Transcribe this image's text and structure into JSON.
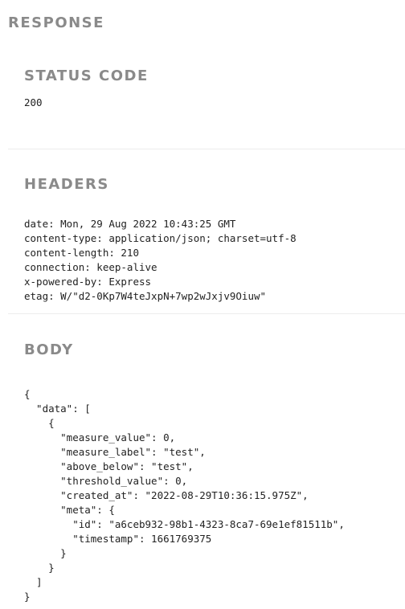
{
  "response": {
    "title": "RESPONSE",
    "status": {
      "title": "STATUS CODE",
      "code": "200"
    },
    "headers": {
      "title": "HEADERS",
      "lines": [
        "date: Mon, 29 Aug 2022 10:43:25 GMT",
        "content-type: application/json; charset=utf-8",
        "content-length: 210",
        "connection: keep-alive",
        "x-powered-by: Express",
        "etag: W/\"d2-0Kp7W4teJxpN+7wp2wJxjv9Oiuw\""
      ]
    },
    "body": {
      "title": "BODY",
      "lines": [
        "{",
        "  \"data\": [",
        "    {",
        "      \"measure_value\": 0,",
        "      \"measure_label\": \"test\",",
        "      \"above_below\": \"test\",",
        "      \"threshold_value\": 0,",
        "      \"created_at\": \"2022-08-29T10:36:15.975Z\",",
        "      \"meta\": {",
        "        \"id\": \"a6ceb932-98b1-4323-8ca7-69e1ef81511b\",",
        "        \"timestamp\": 1661769375",
        "      }",
        "    }",
        "  ]",
        "}"
      ]
    }
  }
}
